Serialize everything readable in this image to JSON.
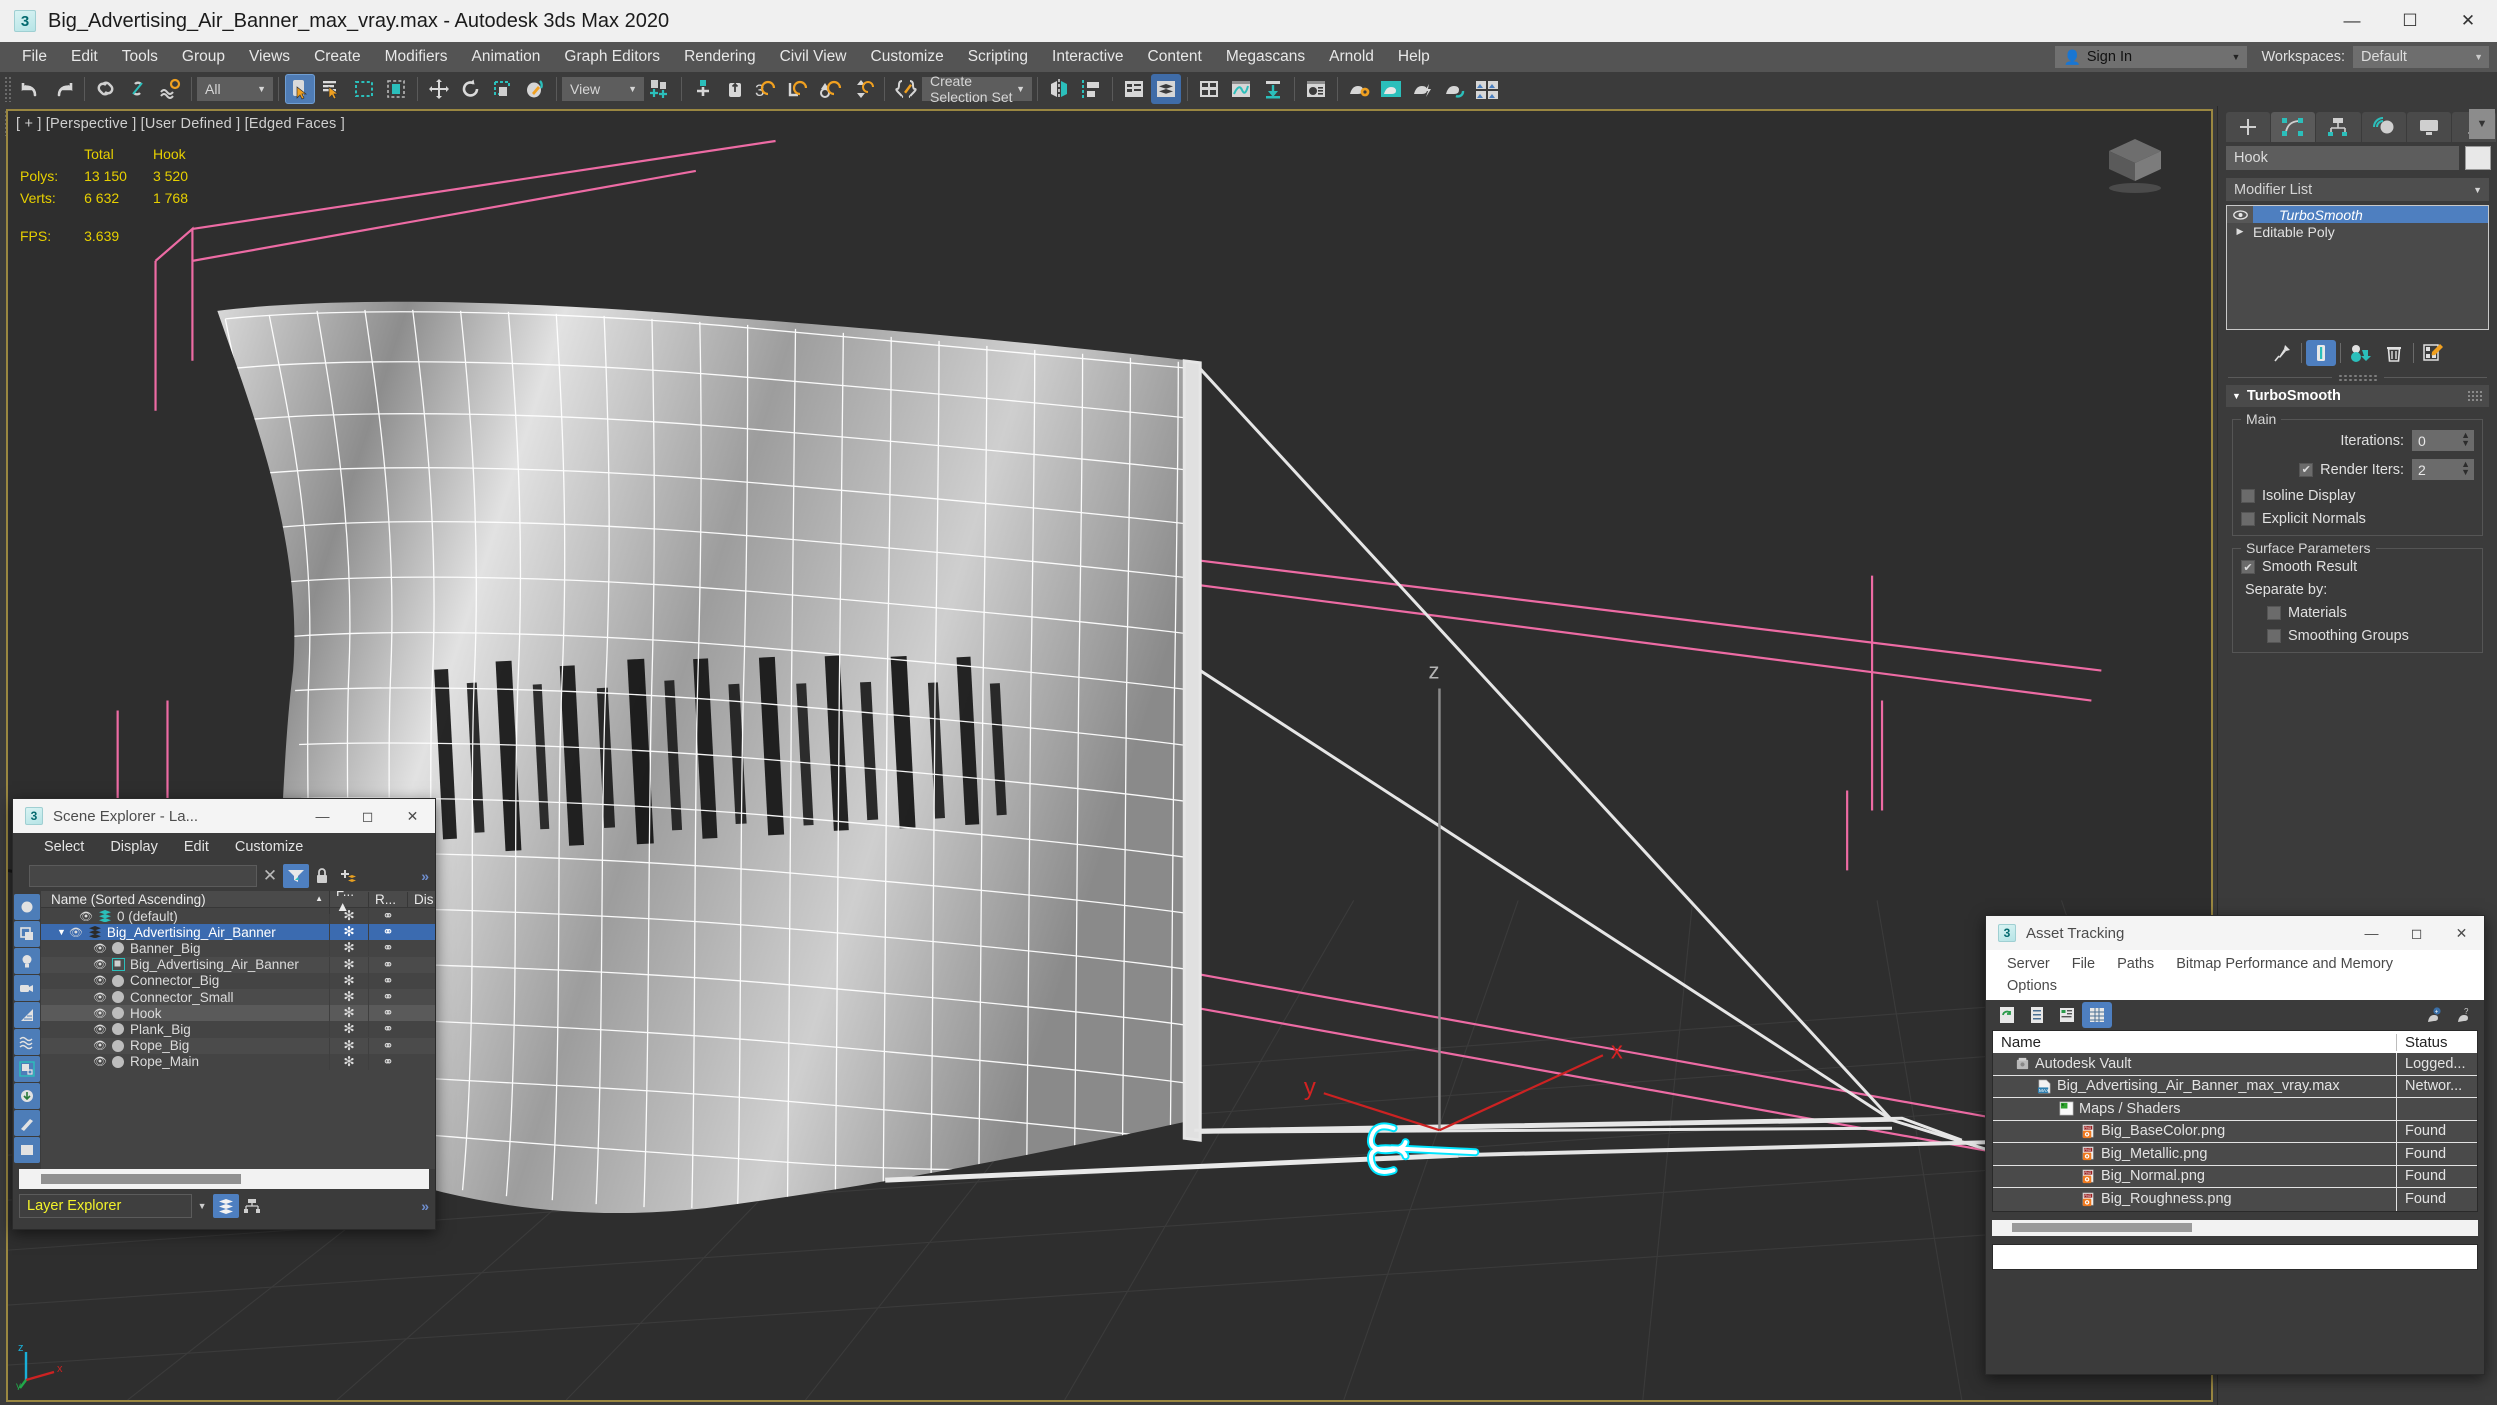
{
  "titlebar": {
    "app_icon": "3dsmax-logo-icon",
    "title": "Big_Advertising_Air_Banner_max_vray.max - Autodesk 3ds Max 2020",
    "minimize": "—",
    "maximize": "☐",
    "close": "✕"
  },
  "menubar": {
    "items": [
      "File",
      "Edit",
      "Tools",
      "Group",
      "Views",
      "Create",
      "Modifiers",
      "Animation",
      "Graph Editors",
      "Rendering",
      "Civil View",
      "Customize",
      "Scripting",
      "Interactive",
      "Content",
      "Megascans",
      "Arnold",
      "Help"
    ],
    "sign_in": "Sign In",
    "workspaces_label": "Workspaces:",
    "workspace_value": "Default"
  },
  "toolbar": {
    "selection_filter": "All",
    "reference_coord": "View",
    "selection_set": "Create Selection Set",
    "icons_row1": [
      "undo-icon",
      "redo-icon",
      "select-and-link-icon",
      "unlink-selection-icon",
      "bind-to-space-warp-icon",
      "selection-filter-combo",
      "select-object-icon",
      "select-by-name-icon",
      "rectangular-selection-region-icon",
      "window-crossing-icon",
      "select-and-move-icon",
      "select-and-rotate-icon",
      "select-and-uniform-scale-icon",
      "select-and-place-icon",
      "reference-coordinate-combo",
      "use-pivot-point-center-icon",
      "select-and-manipulate-icon",
      "snaps-toggle-3d-icon",
      "angle-snap-toggle-icon",
      "percent-snap-toggle-icon",
      "spinner-snap-toggle-icon",
      "edit-named-selection-sets-icon",
      "mirror-icon",
      "align-icon",
      "layer-explorer-icon",
      "scene-explorer-icon",
      "toggle-ribbon-icon",
      "curve-editor-icon",
      "schematic-view-icon",
      "material-editor-icon",
      "render-setup-icon",
      "rendered-frame-window-icon",
      "render-production-icon",
      "render-iterative-icon",
      "open-asset-tracking-icon"
    ],
    "icons_row2": [
      "teapot-icon",
      "cloud-icon",
      "material-preview-icon",
      "list-panel-icon",
      "slider-panel-icon",
      "light-icon",
      "camera-icon",
      "camera-target-icon",
      "box-icon",
      "sphere-gray-icon",
      "sphere-orange-icon",
      "cone-icon",
      "pyramid-icon",
      "sunlight-icon",
      "omni-light-icon",
      "pin-icon",
      "helix-icon",
      "spiral-icon",
      "torus-icon",
      "teapot-blue-icon",
      "banner-icon",
      "particle-icon",
      "help-icon"
    ]
  },
  "viewport": {
    "label": "[ + ] [Perspective ] [User Defined ] [Edged Faces ]",
    "stats": {
      "col_headers": [
        "",
        "Total",
        "Hook"
      ],
      "rows": [
        {
          "label": "Polys:",
          "total": "13 150",
          "hook": "3 520"
        },
        {
          "label": "Verts:",
          "total": "6 632",
          "hook": "1 768"
        }
      ],
      "fps_label": "FPS:",
      "fps_value": "3.639"
    },
    "gizmo_axes": [
      "x",
      "y",
      "z"
    ],
    "tripod_axes": [
      "x",
      "y",
      "z"
    ],
    "colors": {
      "background": "#2e2e2e",
      "border": "#9a8741",
      "stats_text": "#e7d000",
      "selection_highlight": "#00e5ff",
      "helper_pink": "#e8609a",
      "axis_red": "#d22a2a",
      "mesh_wire": "#e9e9e9"
    }
  },
  "command_panel": {
    "tabs": [
      "create-tab",
      "modify-tab",
      "hierarchy-tab",
      "motion-tab",
      "display-tab",
      "utilities-tab"
    ],
    "active_tab_index": 1,
    "object_name": "Hook",
    "modifier_list_label": "Modifier List",
    "stack": [
      {
        "name": "TurboSmooth",
        "active": true,
        "eye": true
      },
      {
        "name": "Editable Poly",
        "active": false,
        "eye": false
      }
    ],
    "stack_tools": [
      "pin-stack-icon",
      "show-end-result-icon",
      "make-unique-icon",
      "remove-modifier-icon",
      "configure-modifier-sets-icon"
    ],
    "rollout": {
      "title": "TurboSmooth",
      "groups": [
        {
          "label": "Main",
          "fields": [
            {
              "type": "spinner",
              "label": "Iterations:",
              "value": "0",
              "checkbox": null
            },
            {
              "type": "spinner",
              "label": "Render Iters:",
              "value": "2",
              "checkbox": true
            },
            {
              "type": "checkbox",
              "label": "Isoline Display",
              "checked": false
            },
            {
              "type": "checkbox",
              "label": "Explicit Normals",
              "checked": false
            }
          ]
        },
        {
          "label": "Surface Parameters",
          "fields": [
            {
              "type": "checkbox",
              "label": "Smooth Result",
              "checked": true
            },
            {
              "type": "static",
              "label": "Separate by:"
            },
            {
              "type": "checkbox",
              "label": "Materials",
              "checked": false,
              "indent": true
            },
            {
              "type": "checkbox",
              "label": "Smoothing Groups",
              "checked": false,
              "indent": true
            }
          ]
        }
      ]
    }
  },
  "scene_explorer": {
    "title": "Scene Explorer - La...",
    "menu": [
      "Select",
      "Display",
      "Edit",
      "Customize"
    ],
    "search_value": "",
    "toolbar_icons": [
      "clear-search-icon",
      "filter-icon",
      "lock-icon",
      "add-layer-icon",
      "expand-chevrons-icon"
    ],
    "columns": [
      "Name (Sorted Ascending)",
      "F...",
      "R...",
      "Dis"
    ],
    "rows": [
      {
        "name": "0 (default)",
        "indent": 1,
        "type": "layer",
        "selected": false,
        "expandable": false
      },
      {
        "name": "Big_Advertising_Air_Banner",
        "indent": 1,
        "type": "layer",
        "selected": true,
        "expandable": true
      },
      {
        "name": "Banner_Big",
        "indent": 2,
        "type": "object",
        "selected": false,
        "expandable": false
      },
      {
        "name": "Big_Advertising_Air_Banner",
        "indent": 2,
        "type": "group",
        "selected": false,
        "expandable": false
      },
      {
        "name": "Connector_Big",
        "indent": 2,
        "type": "object",
        "selected": false,
        "expandable": false
      },
      {
        "name": "Connector_Small",
        "indent": 2,
        "type": "object",
        "selected": false,
        "expandable": false
      },
      {
        "name": "Hook",
        "indent": 2,
        "type": "object",
        "selected": false,
        "highlight": true,
        "expandable": false
      },
      {
        "name": "Plank_Big",
        "indent": 2,
        "type": "object",
        "selected": false,
        "expandable": false
      },
      {
        "name": "Rope_Big",
        "indent": 2,
        "type": "object",
        "selected": false,
        "expandable": false
      },
      {
        "name": "Rope_Main",
        "indent": 2,
        "type": "object",
        "selected": false,
        "expandable": false
      }
    ],
    "footer_combo": "Layer Explorer",
    "footer_icons": [
      "layer-explorer-view-icon",
      "hierarchy-view-icon",
      "expand-chevrons-icon"
    ]
  },
  "asset_tracking": {
    "title": "Asset Tracking",
    "menu": [
      "Server",
      "File",
      "Paths",
      "Bitmap Performance and Memory",
      "Options"
    ],
    "toolbar_icons": [
      "refresh-icon",
      "list-view-icon",
      "detail-view-icon",
      "grid-view-icon",
      "help1-icon",
      "help2-icon"
    ],
    "columns": [
      "Name",
      "Status"
    ],
    "rows": [
      {
        "name": "Autodesk Vault",
        "status": "Logged...",
        "indent": 1,
        "icon": "vault-icon"
      },
      {
        "name": "Big_Advertising_Air_Banner_max_vray.max",
        "status": "Networ...",
        "indent": 2,
        "icon": "max-file-icon"
      },
      {
        "name": "Maps / Shaders",
        "status": "",
        "indent": 3,
        "icon": "maps-folder-icon"
      },
      {
        "name": "Big_BaseColor.png",
        "status": "Found",
        "indent": 4,
        "icon": "png-file-icon"
      },
      {
        "name": "Big_Metallic.png",
        "status": "Found",
        "indent": 4,
        "icon": "png-file-icon"
      },
      {
        "name": "Big_Normal.png",
        "status": "Found",
        "indent": 4,
        "icon": "png-file-icon"
      },
      {
        "name": "Big_Roughness.png",
        "status": "Found",
        "indent": 4,
        "icon": "png-file-icon"
      }
    ]
  }
}
